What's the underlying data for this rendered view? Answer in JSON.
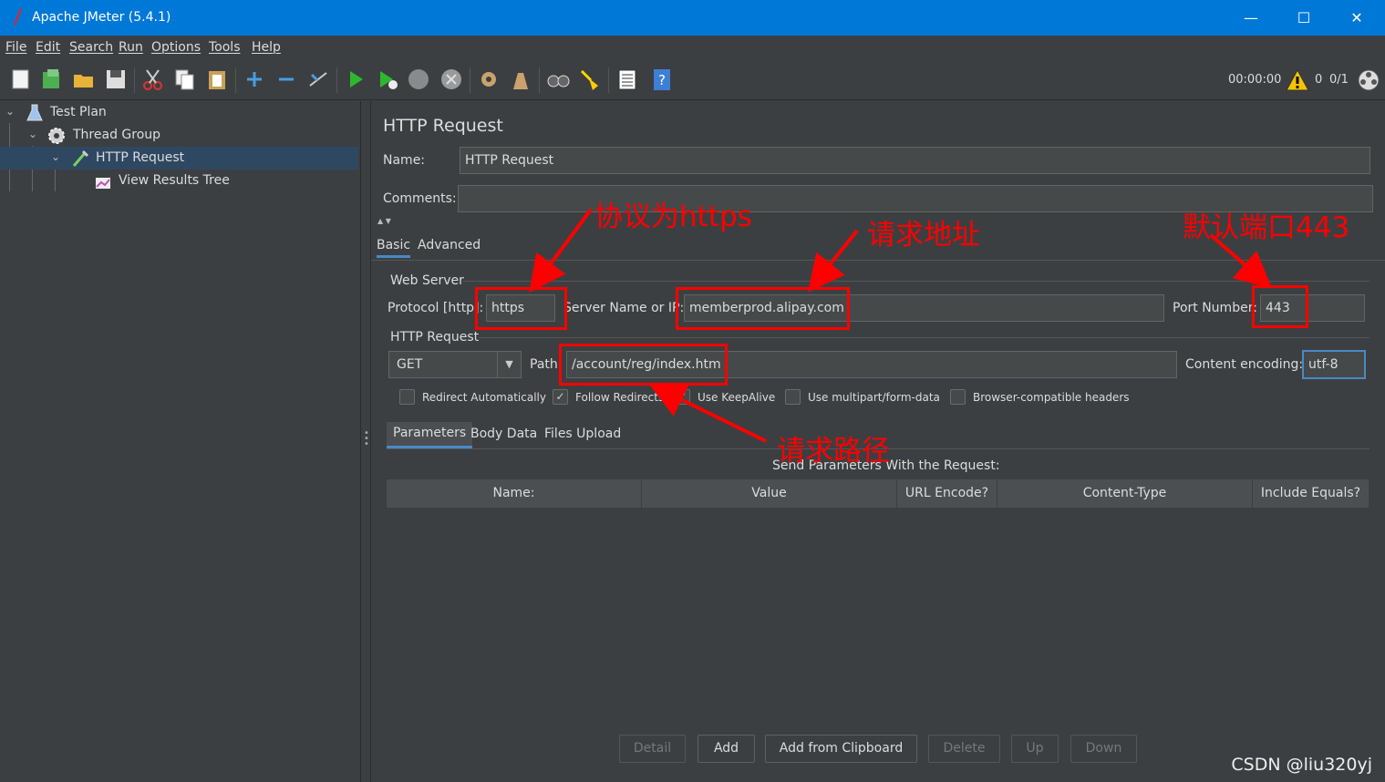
{
  "window": {
    "title": "Apache JMeter (5.4.1)",
    "minimize": "—",
    "maximize": "☐",
    "close": "✕"
  },
  "menu": [
    "File",
    "Edit",
    "Search",
    "Run",
    "Options",
    "Tools",
    "Help"
  ],
  "toolbar": {
    "timer": "00:00:00",
    "warning_count": "0",
    "thread_count": "0/1"
  },
  "tree": [
    {
      "label": "Test Plan",
      "level": 0,
      "icon": "flask-icon"
    },
    {
      "label": "Thread Group",
      "level": 1,
      "icon": "gear-icon"
    },
    {
      "label": "HTTP Request",
      "level": 2,
      "icon": "pipette-icon",
      "selected": true
    },
    {
      "label": "View Results Tree",
      "level": 3,
      "icon": "graph-icon"
    }
  ],
  "panel": {
    "title": "HTTP Request",
    "name_label": "Name:",
    "name_value": "HTTP Request",
    "comments_label": "Comments:",
    "comments_value": "",
    "tabs": [
      "Basic",
      "Advanced"
    ],
    "web_server": {
      "title": "Web Server",
      "protocol_label": "Protocol [http]:",
      "protocol_value": "https",
      "server_label": "Server Name or IP:",
      "server_value": "memberprod.alipay.com",
      "port_label": "Port Number:",
      "port_value": "443"
    },
    "http_request": {
      "title": "HTTP Request",
      "method": "GET",
      "path_label": "Path:",
      "path_value": "/account/reg/index.htm",
      "encoding_label": "Content encoding:",
      "encoding_value": "utf-8"
    },
    "checkboxes": [
      {
        "label": "Redirect Automatically",
        "checked": false
      },
      {
        "label": "Follow Redirects",
        "checked": true
      },
      {
        "label": "Use KeepAlive",
        "checked": true
      },
      {
        "label": "Use multipart/form-data",
        "checked": false
      },
      {
        "label": "Browser-compatible headers",
        "checked": false
      }
    ],
    "sub_tabs": [
      "Parameters",
      "Body Data",
      "Files Upload"
    ],
    "params_caption": "Send Parameters With the Request:",
    "columns": [
      "Name:",
      "Value",
      "URL Encode?",
      "Content-Type",
      "Include Equals?"
    ],
    "buttons": [
      {
        "label": "Detail",
        "enabled": false
      },
      {
        "label": "Add",
        "enabled": true
      },
      {
        "label": "Add from Clipboard",
        "enabled": true
      },
      {
        "label": "Delete",
        "enabled": false
      },
      {
        "label": "Up",
        "enabled": false
      },
      {
        "label": "Down",
        "enabled": false
      }
    ]
  },
  "annotations": {
    "protocol_note": "协议为https",
    "server_note": "请求地址",
    "port_note": "默认端口443",
    "path_note": "请求路径"
  },
  "watermark": "CSDN @liu320yj"
}
